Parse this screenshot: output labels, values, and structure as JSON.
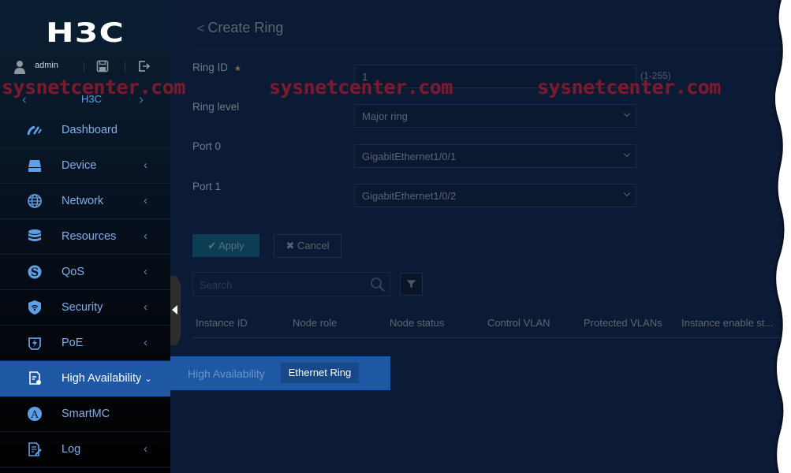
{
  "brand": {
    "logo": "H3C"
  },
  "user": {
    "name": "admin",
    "icons": [
      "user-icon",
      "save-icon",
      "logout-icon"
    ]
  },
  "device_switcher": {
    "device": "H3C",
    "prev": "‹",
    "next": "›"
  },
  "watermark": "sysnetcenter.com",
  "nav": {
    "items": [
      {
        "label": "Dashboard",
        "icon": "dashboard-icon",
        "chevron": ""
      },
      {
        "label": "Device",
        "icon": "device-icon",
        "chevron": "‹"
      },
      {
        "label": "Network",
        "icon": "globe-icon",
        "chevron": "‹"
      },
      {
        "label": "Resources",
        "icon": "database-icon",
        "chevron": "‹"
      },
      {
        "label": "QoS",
        "icon": "qos-icon",
        "chevron": "‹"
      },
      {
        "label": "Security",
        "icon": "shield-icon",
        "chevron": "‹"
      },
      {
        "label": "PoE",
        "icon": "poe-icon",
        "chevron": "‹"
      },
      {
        "label": "High Availability",
        "icon": "high-availability-icon",
        "chevron": "⌄"
      },
      {
        "label": "SmartMC",
        "icon": "smartmc-icon",
        "chevron": ""
      },
      {
        "label": "Log",
        "icon": "log-icon",
        "chevron": "‹"
      }
    ],
    "active": "High Availability"
  },
  "submenu": {
    "parent": "High Availability",
    "active_item": "Ethernet Ring"
  },
  "page": {
    "back": "<",
    "title": "Create Ring",
    "form": {
      "ring_id": {
        "label": "Ring ID",
        "required_mark": "★",
        "value": "1",
        "hint": "(1-255)"
      },
      "ring_level": {
        "label": "Ring level",
        "value": "Major ring"
      },
      "port0": {
        "label": "Port 0",
        "value": "GigabitEthernet1/0/1"
      },
      "port1": {
        "label": "Port 1",
        "value": "GigabitEthernet1/0/2"
      }
    },
    "buttons": {
      "apply": "✔ Apply",
      "cancel": "✖ Cancel"
    },
    "search": {
      "placeholder": "Search",
      "value": ""
    },
    "table": {
      "columns": [
        "Instance ID",
        "Node role",
        "Node status",
        "Control VLAN",
        "Protected VLANs",
        "Instance enable st..."
      ],
      "rows": []
    }
  }
}
